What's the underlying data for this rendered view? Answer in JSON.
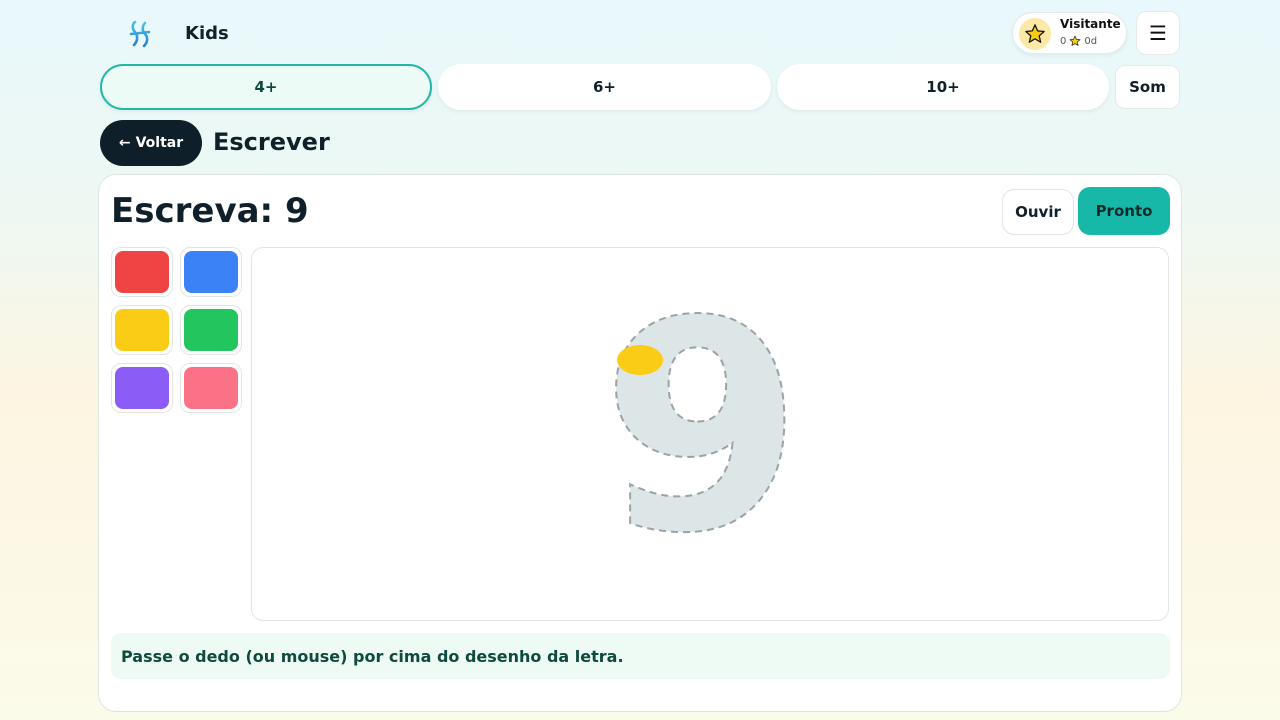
{
  "header": {
    "brand": "Kids",
    "logo_icon": "music-clef-logo",
    "user": {
      "name": "Visitante",
      "points": "0",
      "days": "0d"
    },
    "menu_icon": "hamburger-icon",
    "menu_glyph": "☰"
  },
  "age_tabs": [
    {
      "label": "4+",
      "active": true
    },
    {
      "label": "6+",
      "active": false
    },
    {
      "label": "10+",
      "active": false
    }
  ],
  "sound_label": "Som",
  "back": {
    "arrow": "←",
    "label": "Voltar"
  },
  "section_title": "Escrever",
  "exercise": {
    "prompt": "Escreva: 9",
    "glyph": "9",
    "listen_label": "Ouvir",
    "done_label": "Pronto",
    "hint": "Passe o dedo (ou mouse) por cima do desenho da letra."
  },
  "palette": [
    "#ef4444",
    "#3b82f6",
    "#facc15",
    "#22c55e",
    "#8b5cf6",
    "#fb7185"
  ],
  "selected_color": "#facc15",
  "colors": {
    "accent": "#17b8a8",
    "dark": "#0f1f2a",
    "trace_fill": "#dde6e7"
  }
}
